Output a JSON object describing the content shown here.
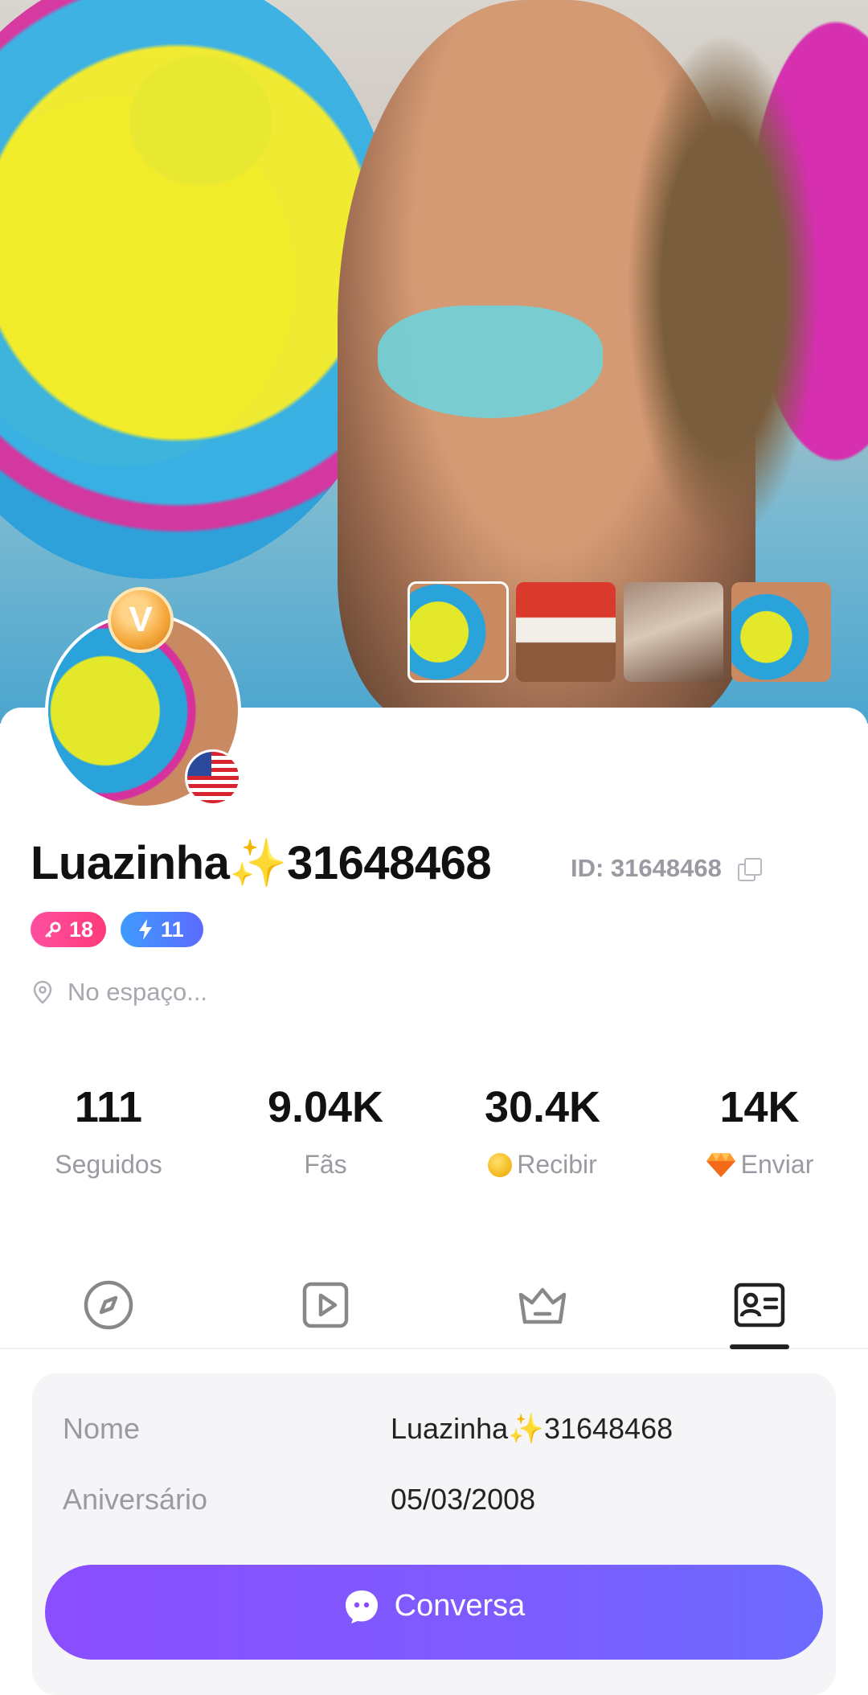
{
  "profile": {
    "name": "Luazinha✨31648468",
    "id_label": "ID: 31648468",
    "vip_letter": "V",
    "badges": [
      {
        "value": "18"
      },
      {
        "value": "11"
      }
    ],
    "location": "No espaço..."
  },
  "stats": [
    {
      "value": "111",
      "label": "Seguidos"
    },
    {
      "value": "9.04K",
      "label": "Fãs"
    },
    {
      "value": "30.4K",
      "label": "Recibir"
    },
    {
      "value": "14K",
      "label": "Enviar"
    }
  ],
  "tabs": [
    {
      "icon": "compass-icon"
    },
    {
      "icon": "play-icon"
    },
    {
      "icon": "crown-icon"
    },
    {
      "icon": "id-card-icon",
      "active": true
    }
  ],
  "info": {
    "rows": [
      {
        "key": "Nome",
        "value": "Luazinha✨31648468"
      },
      {
        "key": "Aniversário",
        "value": "05/03/2008"
      }
    ]
  },
  "cta": {
    "label": "Conversa"
  },
  "colors": {
    "accent": "#8a4dff",
    "pink_badge": "#ff3a7a",
    "blue_badge": "#4f7cff"
  }
}
